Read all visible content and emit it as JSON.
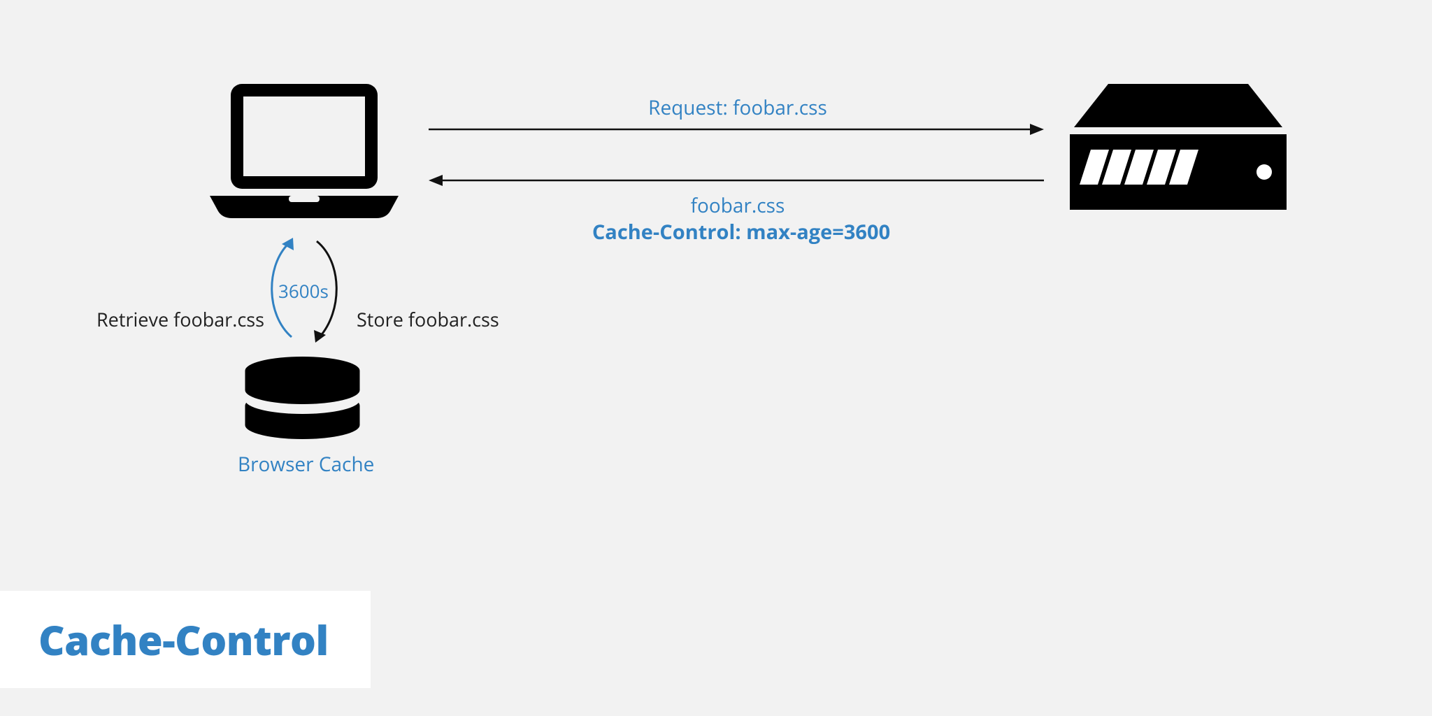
{
  "colors": {
    "blue": "#3282c3",
    "black": "#111111",
    "bg": "#f2f2f2",
    "white": "#ffffff"
  },
  "labels": {
    "request": "Request: foobar.css",
    "response_file": "foobar.css",
    "response_header": "Cache-Control: max-age=3600",
    "retrieve": "Retrieve foobar.css",
    "store": "Store foobar.css",
    "ttl": "3600s",
    "cache": "Browser Cache",
    "title": "Cache-Control"
  },
  "icons": {
    "client": "laptop-icon",
    "server": "server-icon",
    "cache": "disk-cache-icon"
  }
}
